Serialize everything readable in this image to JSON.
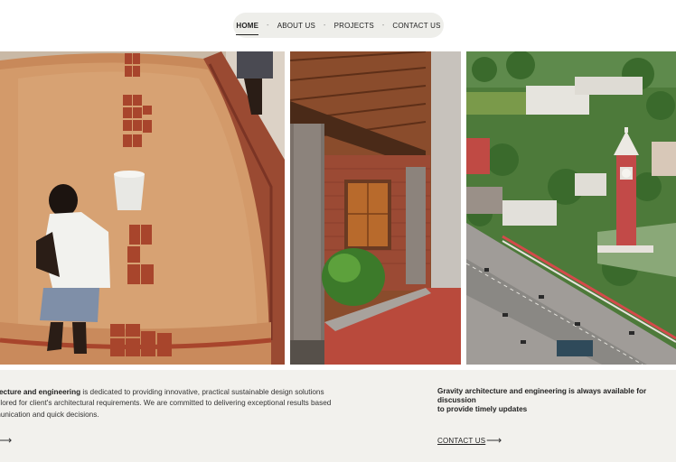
{
  "nav": {
    "items": [
      {
        "label": "HOME",
        "active": true
      },
      {
        "label": "ABOUT US",
        "active": false
      },
      {
        "label": "PROJECTS",
        "active": false
      },
      {
        "label": "CONTACT US",
        "active": false
      }
    ],
    "separator": "-"
  },
  "gallery": {
    "photos": [
      {
        "subject": "worker laying bricks on curved earthen vault"
      },
      {
        "subject": "brick house veranda with timber roof and wooden window"
      },
      {
        "subject": "aerial view of city with red clock tower"
      }
    ]
  },
  "info": {
    "about_bold": "itecture and engineering",
    "about_rest_line1": " is dedicated to providing innovative, practical sustainable design solutions",
    "about_line2": "ailored for client's architectural requirements. We are committed to delivering exceptional results based",
    "about_line3": "munication and quick decisions.",
    "contact_text": "Gravity architecture and engineering is always available for discussion\nto provide timely updates",
    "contact_link": "CONTACT US",
    "arrow_glyph": "⟶"
  },
  "colors": {
    "nav_bg": "#eeeeea",
    "info_bg": "#f2f1ed",
    "brick": "#a8452c",
    "clay": "#d39a6a"
  }
}
